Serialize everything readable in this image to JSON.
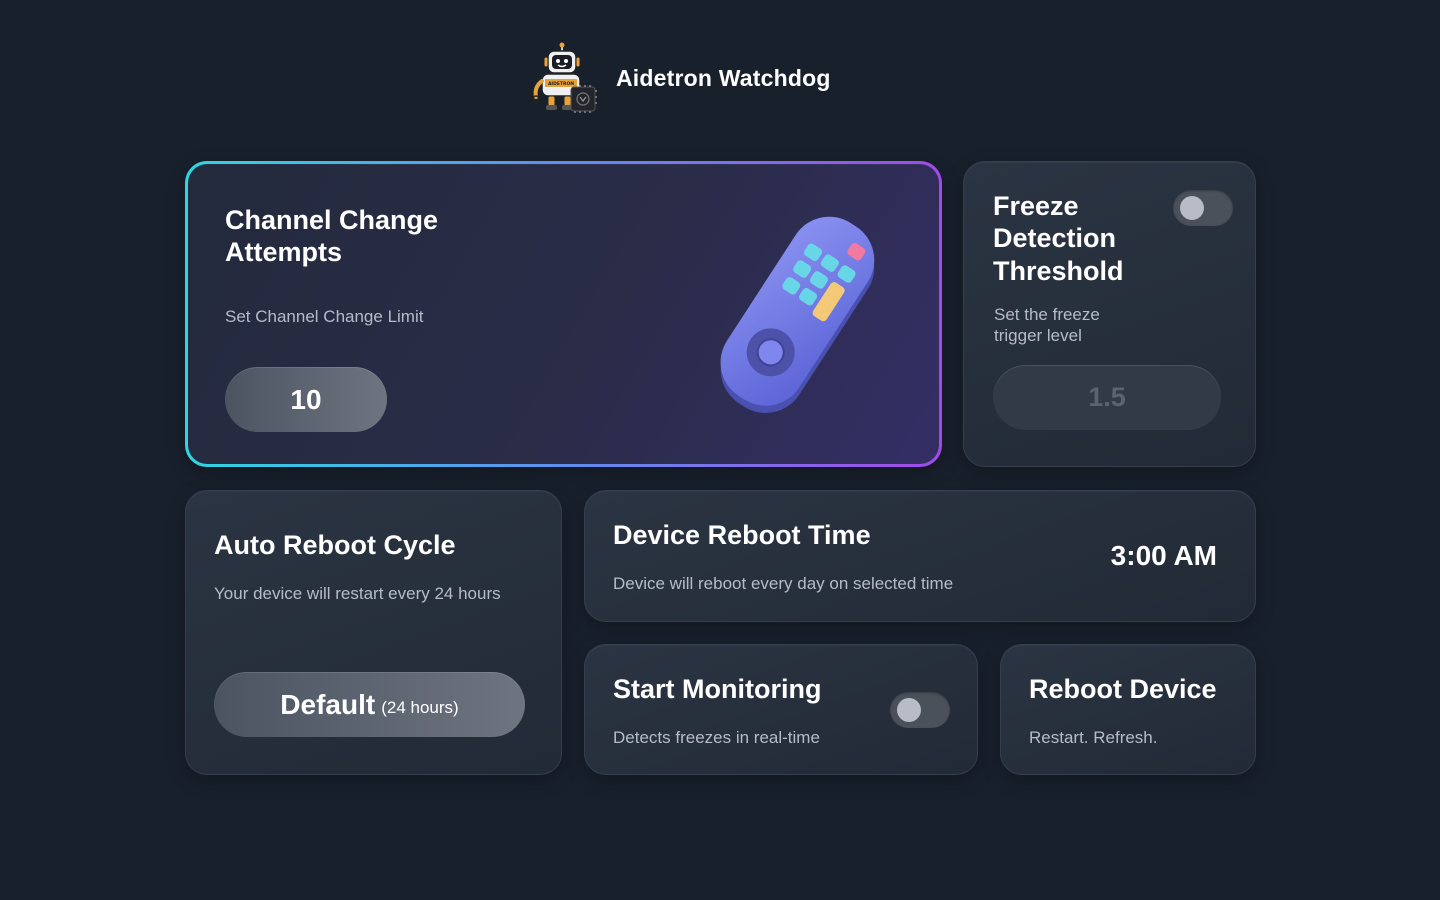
{
  "app": {
    "title": "Aidetron Watchdog",
    "logo_icon": "robot-mascot-icon",
    "logo_text": "AIDETRON"
  },
  "channel_change": {
    "title": "Channel Change Attempts",
    "subtitle": "Set Channel Change Limit",
    "value": "10",
    "illustration": "tv-remote-icon",
    "border_gradient": [
      "#2fd6e0",
      "#5f8ef0",
      "#a24ae8"
    ]
  },
  "freeze_detection": {
    "title": "Freeze Detection Threshold",
    "subtitle": "Set the freeze trigger level",
    "value": "1.5",
    "toggle_on": false
  },
  "auto_reboot": {
    "title": "Auto Reboot Cycle",
    "subtitle": "Your device will restart every 24 hours",
    "button_label": "Default",
    "button_sublabel": "(24 hours)"
  },
  "device_reboot_time": {
    "title": "Device Reboot Time",
    "subtitle": "Device will reboot every day on selected time",
    "time": "3:00 AM"
  },
  "start_monitoring": {
    "title": "Start Monitoring",
    "subtitle": "Detects freezes in real-time",
    "toggle_on": false
  },
  "reboot_device": {
    "title": "Reboot Device",
    "subtitle": "Restart. Refresh."
  },
  "colors": {
    "background": "#18202c",
    "card": "#262e3b",
    "toggle_off": "#4b515b"
  }
}
